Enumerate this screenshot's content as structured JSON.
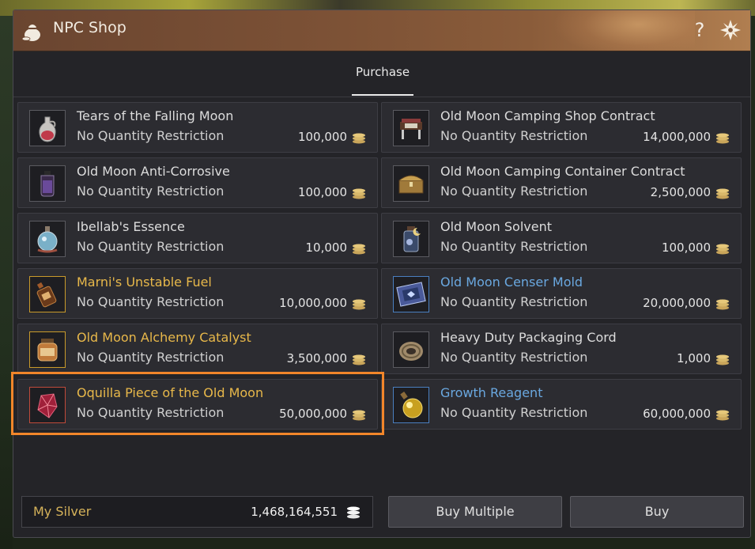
{
  "window": {
    "title": "NPC Shop",
    "help_icon": "question-mark-icon",
    "settings_icon": "gear-flower-icon"
  },
  "tabs": [
    {
      "label": "Purchase",
      "active": true
    }
  ],
  "items": [
    {
      "name": "Tears of the Falling Moon",
      "restriction": "No Quantity Restriction",
      "price": "100,000",
      "grade": "white",
      "icon": "potion-flask-icon"
    },
    {
      "name": "Old Moon Camping Shop Contract",
      "restriction": "No Quantity Restriction",
      "price": "14,000,000",
      "grade": "white",
      "icon": "shop-stall-icon"
    },
    {
      "name": "Old Moon Anti-Corrosive",
      "restriction": "No Quantity Restriction",
      "price": "100,000",
      "grade": "white",
      "icon": "purple-vial-icon"
    },
    {
      "name": "Old Moon Camping Container Contract",
      "restriction": "No Quantity Restriction",
      "price": "2,500,000",
      "grade": "white",
      "icon": "treasure-chest-icon"
    },
    {
      "name": "Ibellab's Essence",
      "restriction": "No Quantity Restriction",
      "price": "10,000",
      "grade": "white",
      "icon": "essence-bottle-icon"
    },
    {
      "name": "Old Moon Solvent",
      "restriction": "No Quantity Restriction",
      "price": "100,000",
      "grade": "white",
      "icon": "moon-jar-icon"
    },
    {
      "name": "Marni's Unstable Fuel",
      "restriction": "No Quantity Restriction",
      "price": "10,000,000",
      "grade": "gold",
      "icon": "fuel-bottle-icon"
    },
    {
      "name": "Old Moon Censer Mold",
      "restriction": "No Quantity Restriction",
      "price": "20,000,000",
      "grade": "blue",
      "icon": "mold-plate-icon"
    },
    {
      "name": "Old Moon Alchemy Catalyst",
      "restriction": "No Quantity Restriction",
      "price": "3,500,000",
      "grade": "gold",
      "icon": "catalyst-jar-icon"
    },
    {
      "name": "Heavy Duty Packaging Cord",
      "restriction": "No Quantity Restriction",
      "price": "1,000",
      "grade": "white",
      "icon": "rope-coil-icon"
    },
    {
      "name": "Oquilla Piece of the Old Moon",
      "restriction": "No Quantity Restriction",
      "price": "50,000,000",
      "grade": "red",
      "icon": "red-crystal-icon",
      "highlighted": true
    },
    {
      "name": "Growth Reagent",
      "restriction": "No Quantity Restriction",
      "price": "60,000,000",
      "grade": "blue",
      "icon": "reagent-flask-icon"
    }
  ],
  "footer": {
    "silver_label": "My Silver",
    "silver_value": "1,468,164,551",
    "buy_multiple_label": "Buy Multiple",
    "buy_label": "Buy"
  },
  "colors": {
    "highlight": "#f2862a",
    "gold_grade": "#e8b84a",
    "blue_grade": "#6aa8e0",
    "title_bar": "#7d5236"
  }
}
